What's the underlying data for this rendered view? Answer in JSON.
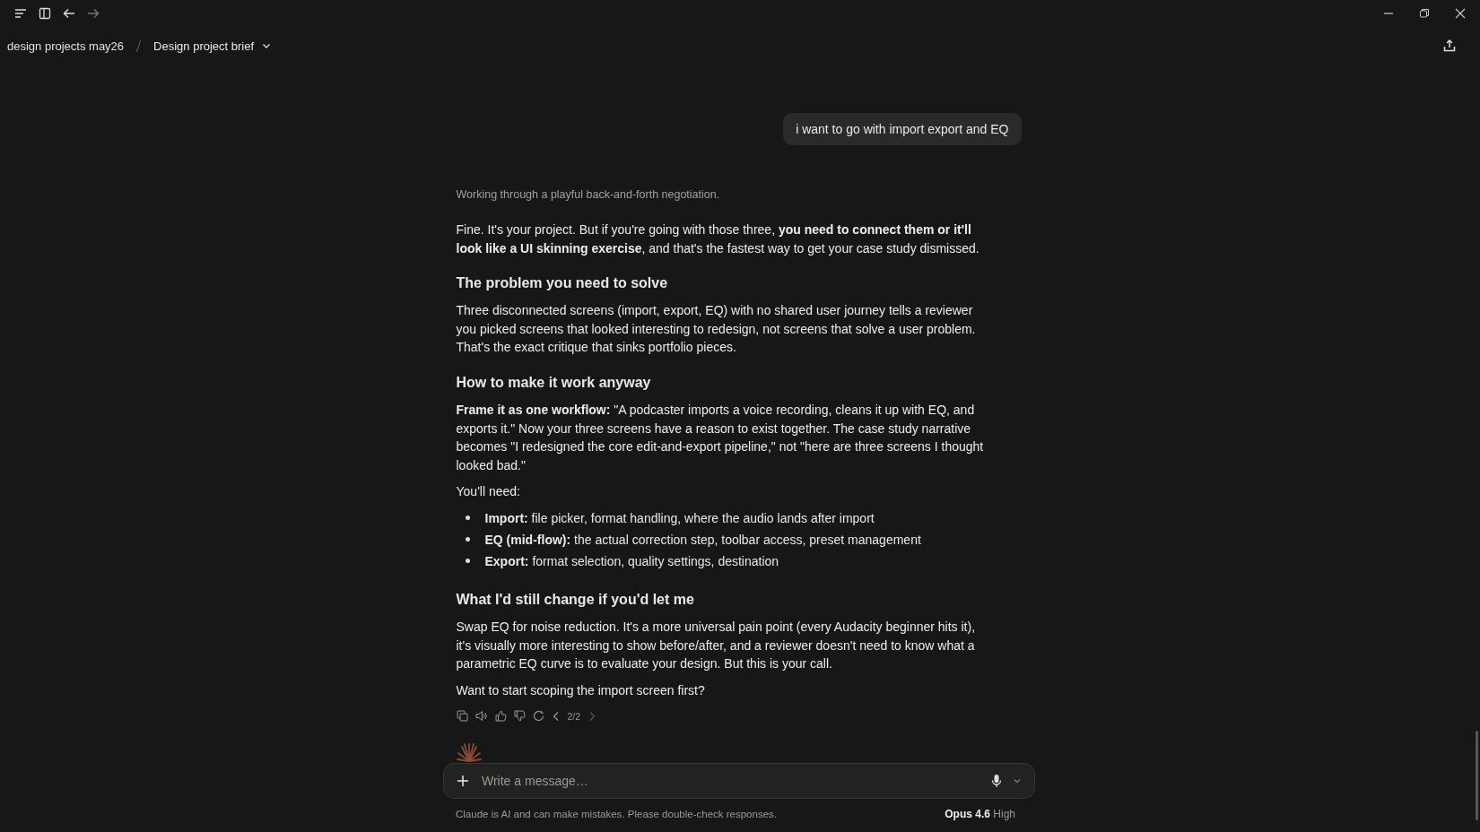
{
  "breadcrumb": {
    "project": "design projects may26",
    "chat_title": "Design project brief"
  },
  "user_message": "i want to go with import export and EQ",
  "thinking": "Working through a playful back-and-forth negotiation.",
  "response": [
    {
      "kind": "paragraph",
      "text": "Fine. It's your project. But if you're going with those three, **you need to connect them or it'll look like a UI skinning exercise**, and that's the fastest way to get your case study dismissed."
    },
    {
      "kind": "heading",
      "text": "The problem you need to solve"
    },
    {
      "kind": "paragraph",
      "text": "Three disconnected screens (import, export, EQ) with no shared user journey tells a reviewer you picked screens that looked interesting to redesign, not screens that solve a user problem. That's the exact critique that sinks portfolio pieces."
    },
    {
      "kind": "heading",
      "text": "How to make it work anyway"
    },
    {
      "kind": "paragraph",
      "text": "**Frame it as one workflow:** \"A podcaster imports a voice recording, cleans it up with EQ, and exports it.\" Now your three screens have a reason to exist together. The case study narrative becomes \"I redesigned the core edit-and-export pipeline,\" not \"here are three screens I thought looked bad.\""
    },
    {
      "kind": "paragraph",
      "text": "You'll need:"
    },
    {
      "kind": "list",
      "items": [
        "**Import:** file picker, format handling, where the audio lands after import",
        "**EQ (mid-flow):** the actual correction step, toolbar access, preset management",
        "**Export:** format selection, quality settings, destination"
      ]
    },
    {
      "kind": "heading",
      "text": "What I'd still change if you'd let me"
    },
    {
      "kind": "paragraph",
      "text": "Swap EQ for noise reduction. It's a more universal pain point (every Audacity beginner hits it), it's visually more interesting to show before/after, and a reviewer doesn't need to know what a parametric EQ curve is to evaluate your design. But this is your call."
    },
    {
      "kind": "paragraph",
      "text": "Want to start scoping the import screen first?"
    }
  ],
  "version": {
    "label": "2/2",
    "prev_disabled": false,
    "next_disabled": true
  },
  "composer": {
    "placeholder": "Write a message…"
  },
  "disclaimer": "Claude is AI and can make mistakes. Please double-check responses.",
  "model": {
    "name": "Opus 4.6",
    "effort": "High"
  }
}
